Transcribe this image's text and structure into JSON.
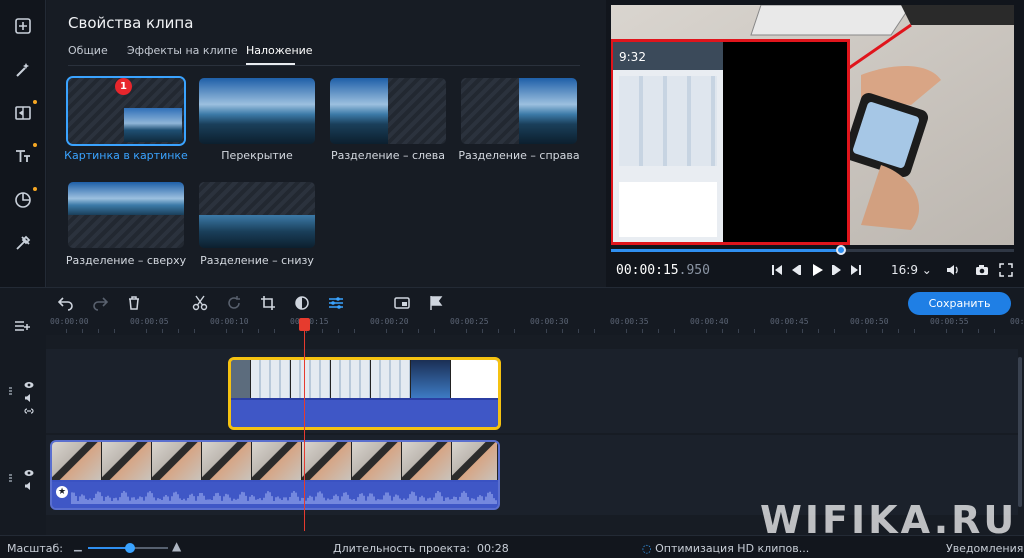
{
  "panel": {
    "title": "Свойства клипа",
    "tabs": [
      {
        "label": "Общие"
      },
      {
        "label": "Эффекты на клипе"
      },
      {
        "label": "Наложение"
      }
    ],
    "badge": "1",
    "tiles": [
      {
        "label": "Картинка в картинке",
        "selected": true
      },
      {
        "label": "Перекрытие"
      },
      {
        "label": "Разделение – слева"
      },
      {
        "label": "Разделение – справа"
      },
      {
        "label": "Разделение – сверху"
      },
      {
        "label": "Разделение – снизу"
      }
    ]
  },
  "rail_icons": [
    "import-icon",
    "magic-wand-icon",
    "transitions-icon",
    "titles-icon",
    "stickers-icon",
    "tools-icon"
  ],
  "preview": {
    "phone_time": "9:32",
    "timecode_main": "00:00:15",
    "timecode_ms": ".950",
    "aspect": "16:9",
    "progress_fraction": 0.57
  },
  "toolbar": {
    "save_label": "Сохранить",
    "icons": [
      "undo-icon",
      "redo-icon",
      "delete-icon",
      "cut-icon",
      "rotate-icon",
      "crop-icon",
      "color-icon",
      "adjust-icon",
      "pip-icon",
      "flag-icon"
    ]
  },
  "ruler": {
    "ticks": [
      "00:00:00",
      "00:00:05",
      "00:00:10",
      "00:00:15",
      "00:00:20",
      "00:00:25",
      "00:00:30",
      "00:00:35",
      "00:00:40",
      "00:00:45",
      "00:00:50",
      "00:00:55",
      "00:01:00"
    ]
  },
  "status": {
    "scale_label": "Масштаб:",
    "scale_fraction": 0.52,
    "duration_label": "Длительность проекта:",
    "duration_value": "00:28",
    "optimize_label": "Оптимизация HD клипов...",
    "notify_label": "Уведомления"
  },
  "watermark": "WIFIKA.RU",
  "colors": {
    "accent": "#1f7fe5",
    "clip_border": "#f5c211",
    "playhead": "#e63b2e",
    "overlay_frame": "#e0151c"
  }
}
